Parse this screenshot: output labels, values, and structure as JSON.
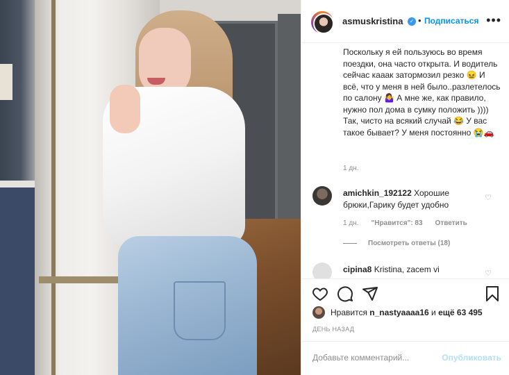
{
  "post": {
    "username": "asmuskristina",
    "follow_label": "Подписаться",
    "separator": "•",
    "more_label": "•••"
  },
  "caption": {
    "text": "Поскольку я ей пользуюсь во время поездки, она часто открыта. И водитель сейчас кааак затормозил резко 😖 И всё, что у меня в ней было..разлетелось по салону 🤷‍♀️ А мне же, как правило, нужно пол дома в сумку положить )))) Так, чисто на всякий случай 😂 У вас такое бывает? У меня постоянно 😭🚗",
    "time": "1 дн."
  },
  "comments": [
    {
      "username": "amichkin_192122",
      "text": "Хорошие брюки,Гарику будет удобно",
      "time": "1 дн.",
      "likes": "\"Нравится\": 83",
      "reply_label": "Ответить",
      "view_replies": "Посмотреть ответы (18)"
    },
    {
      "username": "cipina8",
      "text": "Kristina, zacem vi"
    }
  ],
  "likes": {
    "prefix": "Нравится",
    "user": "n_nastyaaaa16",
    "middle": "и",
    "count": "ещё 63 495"
  },
  "date": "ДЕНЬ НАЗАД",
  "add_comment": {
    "placeholder": "Добавьте комментарий...",
    "publish_label": "Опубликовать"
  },
  "colors": {
    "link": "#0095f6",
    "verified": "#3897f0",
    "muted": "#8e8e8e",
    "publish_disabled": "#b2dffc"
  },
  "icons": [
    "heart-icon",
    "comment-icon",
    "share-icon",
    "bookmark-icon",
    "verified-badge-icon",
    "more-icon"
  ]
}
